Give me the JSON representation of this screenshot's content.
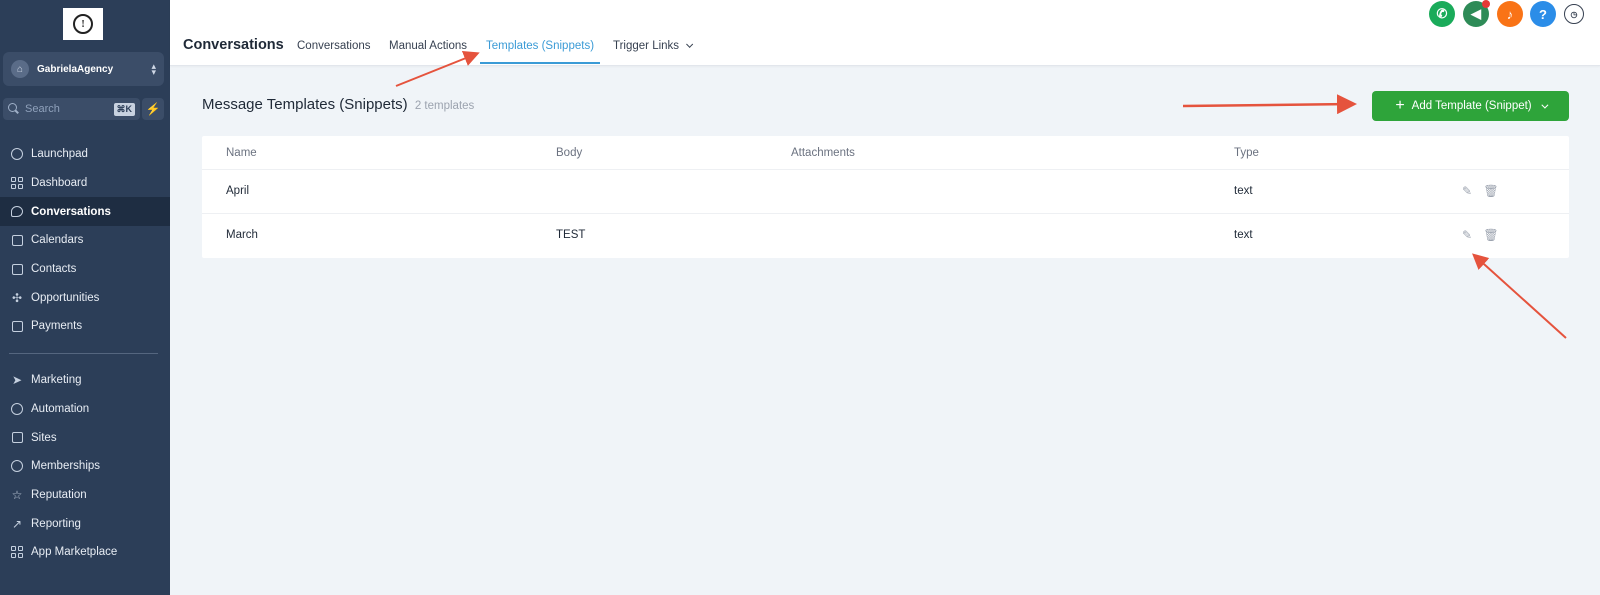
{
  "sidebar": {
    "account_name": "GabrielaAgency",
    "search_placeholder": "Search",
    "search_shortcut": "⌘K",
    "nav_top": [
      {
        "label": "Launchpad",
        "icon": "rocket-icon"
      },
      {
        "label": "Dashboard",
        "icon": "grid-icon"
      },
      {
        "label": "Conversations",
        "icon": "chat-bubble-icon",
        "active": true
      },
      {
        "label": "Calendars",
        "icon": "calendar-icon"
      },
      {
        "label": "Contacts",
        "icon": "contacts-book-icon"
      },
      {
        "label": "Opportunities",
        "icon": "network-icon"
      },
      {
        "label": "Payments",
        "icon": "receipt-icon"
      }
    ],
    "nav_bottom": [
      {
        "label": "Marketing",
        "icon": "paper-plane-icon"
      },
      {
        "label": "Automation",
        "icon": "play-circle-icon"
      },
      {
        "label": "Sites",
        "icon": "browser-icon"
      },
      {
        "label": "Memberships",
        "icon": "award-icon"
      },
      {
        "label": "Reputation",
        "icon": "star-icon"
      },
      {
        "label": "Reporting",
        "icon": "trend-icon"
      },
      {
        "label": "App Marketplace",
        "icon": "apps-grid-icon"
      }
    ]
  },
  "header": {
    "title": "Conversations",
    "tabs": [
      {
        "label": "Conversations"
      },
      {
        "label": "Manual Actions"
      },
      {
        "label": "Templates (Snippets)",
        "active": true
      },
      {
        "label": "Trigger Links"
      }
    ],
    "icon_colors": {
      "phone": "#1aab5a",
      "announce": "#2e8b57",
      "bell": "#f97316",
      "help": "#2b8de8"
    },
    "help_label": "?"
  },
  "main": {
    "heading": "Message Templates (Snippets)",
    "count": "2 templates",
    "add_button": "Add Template (Snippet)",
    "columns": [
      "Name",
      "Body",
      "Attachments",
      "Type"
    ],
    "rows": [
      {
        "name": "April",
        "body": "",
        "attachments": "",
        "type": "text"
      },
      {
        "name": "March",
        "body": "TEST",
        "attachments": "",
        "type": "text"
      }
    ]
  },
  "colors": {
    "sidebar_bg": "#2c3e58",
    "accent": "#3b9bd6",
    "primary_button": "#2ea43a",
    "annotation_arrow": "#e5533d"
  }
}
